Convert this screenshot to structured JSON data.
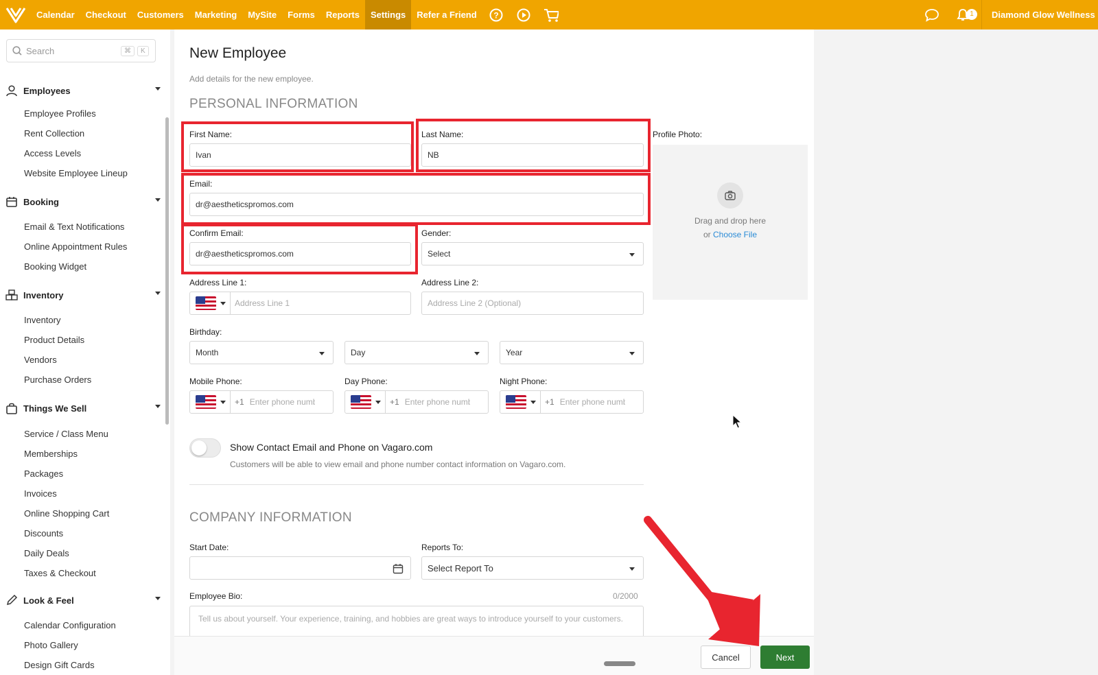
{
  "topbar": {
    "nav": [
      "Calendar",
      "Checkout",
      "Customers",
      "Marketing",
      "MySite",
      "Forms",
      "Reports",
      "Settings",
      "Refer a Friend"
    ],
    "active_nav": "Settings",
    "business_name": "Diamond Glow Wellness Me",
    "notification_count": "1",
    "accent_color": "#f0a500"
  },
  "sidebar": {
    "search_placeholder": "Search",
    "search_key1": "⌘",
    "search_key2": "K",
    "sections": [
      {
        "label": "Employees",
        "icon": "person-icon",
        "items": [
          "Employee Profiles",
          "Rent Collection",
          "Access Levels",
          "Website Employee Lineup"
        ]
      },
      {
        "label": "Booking",
        "icon": "calendar-icon",
        "items": [
          "Email & Text Notifications",
          "Online Appointment Rules",
          "Booking Widget"
        ]
      },
      {
        "label": "Inventory",
        "icon": "boxes-icon",
        "items": [
          "Inventory",
          "Product Details",
          "Vendors",
          "Purchase Orders"
        ]
      },
      {
        "label": "Things We Sell",
        "icon": "bag-icon",
        "items": [
          "Service / Class Menu",
          "Memberships",
          "Packages",
          "Invoices",
          "Online Shopping Cart",
          "Discounts",
          "Daily Deals",
          "Taxes & Checkout"
        ]
      },
      {
        "label": "Look & Feel",
        "icon": "pencil-icon",
        "items": [
          "Calendar Configuration",
          "Photo Gallery",
          "Design Gift Cards"
        ]
      }
    ]
  },
  "form": {
    "title": "New Employee",
    "subtitle": "Add details for the new employee.",
    "personal_heading": "PERSONAL INFORMATION",
    "first_name_label": "First Name:",
    "first_name_value": "Ivan",
    "last_name_label": "Last Name:",
    "last_name_value": "NB",
    "email_label": "Email:",
    "email_value": "dr@aestheticspromos.com",
    "confirm_email_label": "Confirm Email:",
    "confirm_email_value": "dr@aestheticspromos.com",
    "gender_label": "Gender:",
    "gender_value": "Select",
    "address1_label": "Address Line 1:",
    "address1_placeholder": "Address Line 1",
    "address2_label": "Address Line 2:",
    "address2_placeholder": "Address Line 2 (Optional)",
    "birthday_label": "Birthday:",
    "month_value": "Month",
    "day_value": "Day",
    "year_value": "Year",
    "mobile_label": "Mobile Phone:",
    "day_phone_label": "Day Phone:",
    "night_phone_label": "Night Phone:",
    "phone_code": "+1",
    "phone_placeholder": "Enter phone numb",
    "profile_photo_label": "Profile Photo:",
    "photo_drag_text": "Drag and drop here",
    "photo_or": "or",
    "photo_choose": "Choose File",
    "toggle_label": "Show Contact Email and Phone on Vagaro.com",
    "toggle_desc": "Customers will be able to view email and phone number contact information on Vagaro.com.",
    "company_heading": "COMPANY INFORMATION",
    "start_date_label": "Start Date:",
    "reports_to_label": "Reports To:",
    "reports_to_value": "Select Report To",
    "bio_label": "Employee Bio:",
    "bio_count": "0/2000",
    "bio_placeholder": "Tell us about yourself. Your experience, training, and hobbies are great ways to introduce yourself to your customers."
  },
  "footer": {
    "cancel_label": "Cancel",
    "next_label": "Next",
    "next_color": "#2e7d32"
  }
}
